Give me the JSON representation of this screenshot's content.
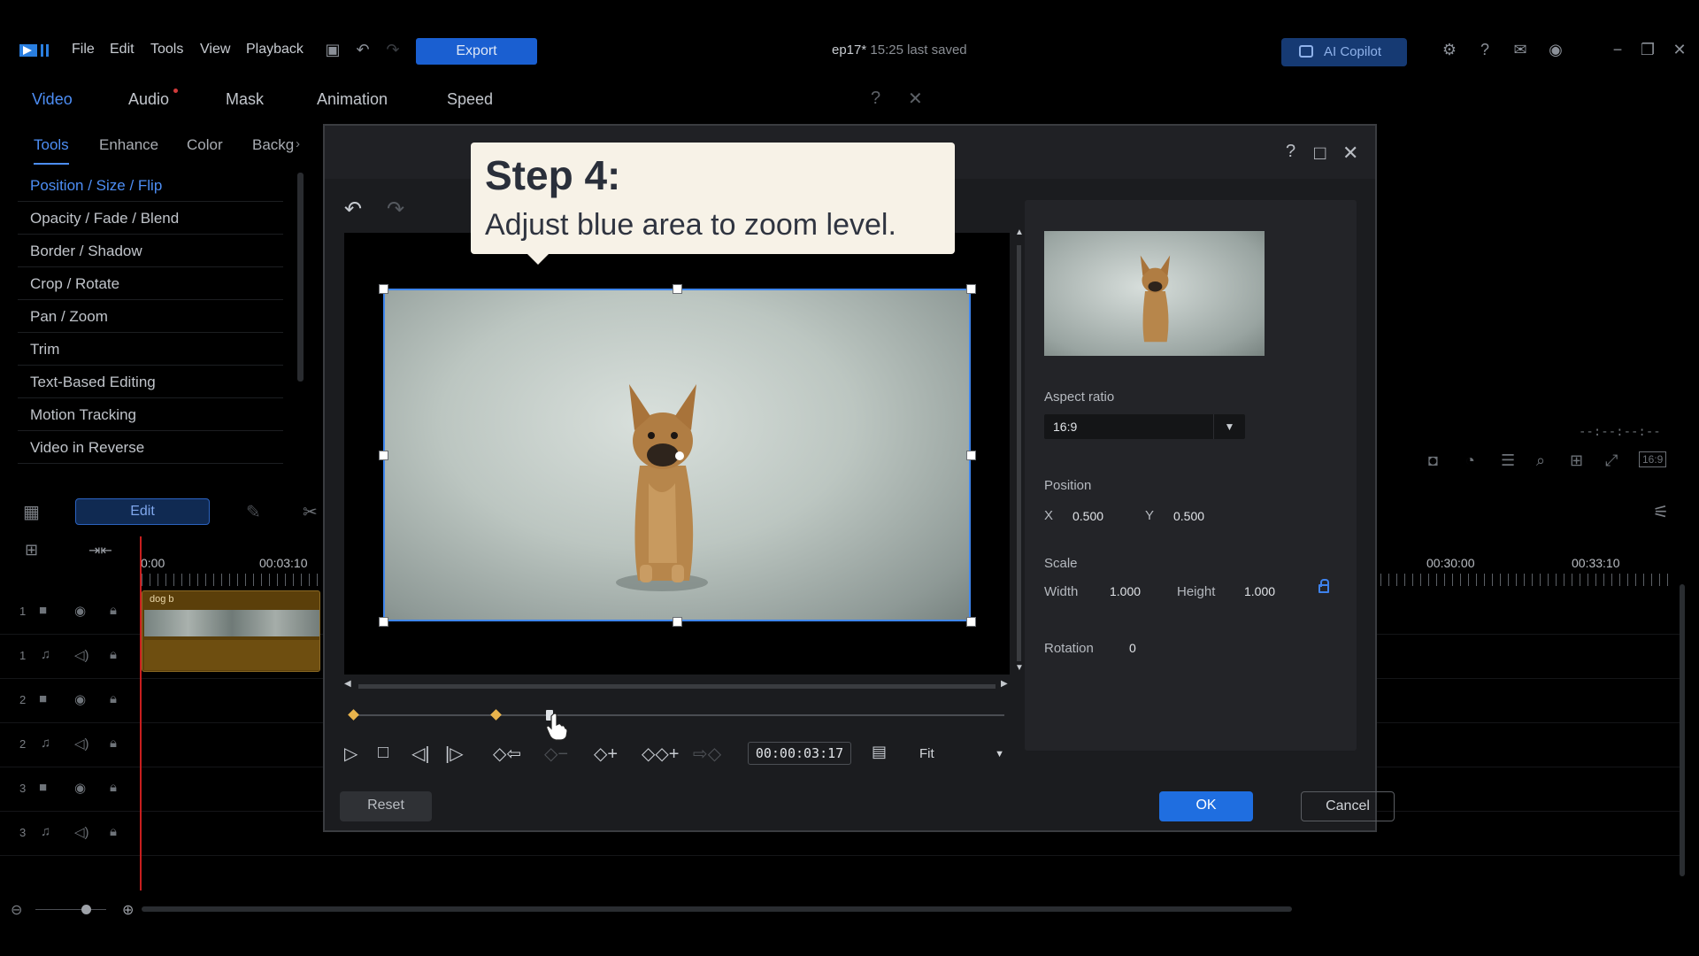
{
  "topbar": {
    "menu": [
      "File",
      "Edit",
      "Tools",
      "View",
      "Playback"
    ],
    "export_label": "Export",
    "doc_name": "ep17*",
    "doc_status": "15:25 last saved",
    "copilot_label": "AI Copilot"
  },
  "left_panel": {
    "tabs": [
      "Video",
      "Audio",
      "Mask",
      "Animation",
      "Speed"
    ],
    "subtabs": [
      "Tools",
      "Enhance",
      "Color",
      "Backg"
    ],
    "tools": [
      "Position / Size / Flip",
      "Opacity / Fade / Blend",
      "Border / Shadow",
      "Crop / Rotate",
      "Pan / Zoom",
      "Trim",
      "Text-Based Editing",
      "Motion Tracking",
      "Video in Reverse"
    ]
  },
  "timeline": {
    "edit_label": "Edit",
    "ruler": [
      "0:00",
      "00:03:10"
    ],
    "ruler_right": [
      "00:30:00",
      "00:33:10"
    ],
    "clip_name": "dog b",
    "tracks": [
      {
        "num": "1",
        "kind": "video"
      },
      {
        "num": "1",
        "kind": "audio"
      },
      {
        "num": "2",
        "kind": "video"
      },
      {
        "num": "2",
        "kind": "audio"
      },
      {
        "num": "3",
        "kind": "video"
      },
      {
        "num": "3",
        "kind": "audio"
      }
    ],
    "timecode_right": "--:--:--:--"
  },
  "dialog": {
    "timecode": "00:00:03:17",
    "fit_label": "Fit",
    "aspect_ratio_label": "Aspect ratio",
    "aspect_ratio_value": "16:9",
    "position_label": "Position",
    "x_label": "X",
    "x_value": "0.500",
    "y_label": "Y",
    "y_value": "0.500",
    "scale_label": "Scale",
    "width_label": "Width",
    "width_value": "1.000",
    "height_label": "Height",
    "height_value": "1.000",
    "rotation_label": "Rotation",
    "rotation_value": "0",
    "reset_label": "Reset",
    "ok_label": "OK",
    "cancel_label": "Cancel"
  },
  "callout": {
    "title": "Step 4:",
    "body": "Adjust blue area to zoom level."
  },
  "colors": {
    "accent": "#3f86ee",
    "keyframe": "#e9b44c",
    "playhead": "#c81e1e"
  }
}
